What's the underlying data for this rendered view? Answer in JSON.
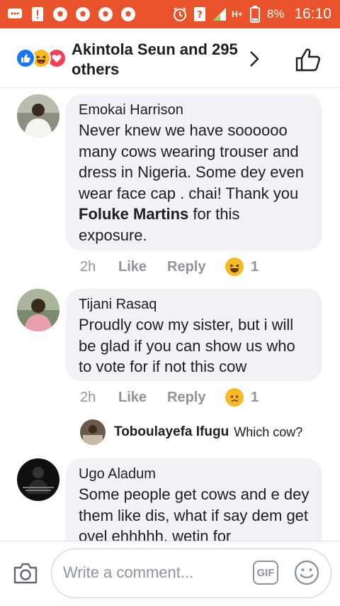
{
  "status_bar": {
    "battery": "8%",
    "time": "16:10",
    "network": "H+"
  },
  "header": {
    "title": "Akintola Seun and 295 others",
    "reaction_icons": [
      "like-icon",
      "haha-icon",
      "love-icon"
    ]
  },
  "comments": [
    {
      "author": "Emokai Harrison",
      "text_before": "Never knew we have soooooo many cows wearing trouser and dress in Nigeria. Some dey even wear face cap . chai! Thank you ",
      "mention": "Foluke Martins",
      "text_after": " for this exposure.",
      "time": "2h",
      "like": "Like",
      "reply": "Reply",
      "reaction": "haha-icon",
      "reaction_count": "1"
    },
    {
      "author": "Tijani Rasaq",
      "text": "Proudly cow my sister, but i will be glad if you can show us who to vote for if not this cow",
      "time": "2h",
      "like": "Like",
      "reply": "Reply",
      "reaction": "sad-icon",
      "reaction_count": "1",
      "reply_preview": {
        "author": "Toboulayefa Ifugu",
        "text": "Which cow?"
      }
    },
    {
      "author": "Ugo Aladum",
      "text": "Some people get cows and e dey them like dis, what if say dem get ovel ehhhhh, wetin for"
    }
  ],
  "composer": {
    "placeholder": "Write a comment...",
    "gif_label": "GIF"
  },
  "colors": {
    "status_bar": "#e8532b",
    "bubble": "#f0f2f5",
    "meta_text": "#90949c",
    "like_blue": "#1877f2"
  }
}
